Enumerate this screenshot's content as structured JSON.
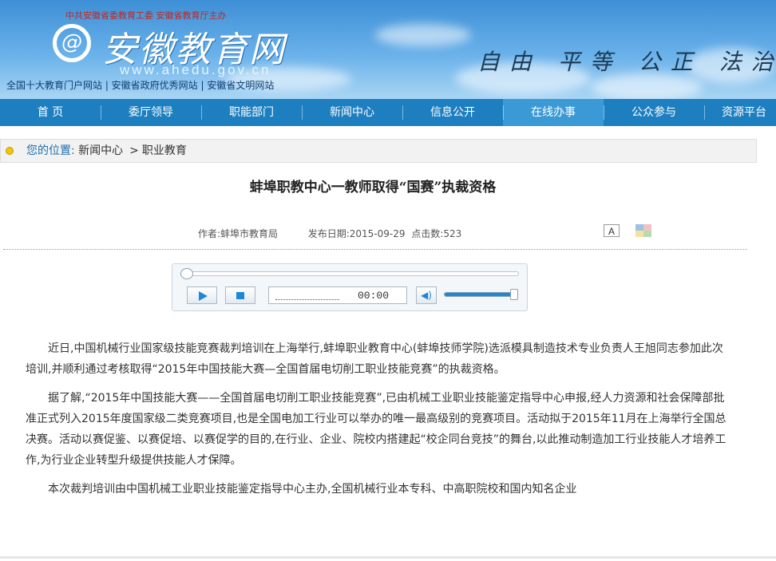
{
  "header": {
    "sponsor": "中共安徽省委教育工委 安徽省教育厅主办",
    "logo_text": "安徽教育网",
    "logo_url": "www.ahedu.gov.cn",
    "tagline": "全国十大教育门户网站 | 安徽省政府优秀网站 | 安徽省文明网站",
    "motto": "自由 平等 公正 法治"
  },
  "nav": {
    "items": [
      "首 页",
      "委厅领导",
      "职能部门",
      "新闻中心",
      "信息公开",
      "在线办事",
      "公众参与",
      "资源平台"
    ],
    "active_index": 5
  },
  "breadcrumb": {
    "label": "您的位置:",
    "section": "新闻中心",
    "separator": ">",
    "current": "职业教育"
  },
  "article": {
    "title": "蚌埠职教中心一教师取得“国赛”执裁资格",
    "author_label": "作者:",
    "author": "蚌埠市教育局",
    "date_label": "发布日期:",
    "date": "2015-09-29",
    "clicks_label": "点击数:",
    "clicks": "523",
    "font_button": "A",
    "paragraphs": [
      "近日,中国机械行业国家级技能竞赛裁判培训在上海举行,蚌埠职业教育中心(蚌埠技师学院)选派模具制造技术专业负责人王旭同志参加此次培训,并顺利通过考核取得“2015年中国技能大赛—全国首届电切削工职业技能竞赛”的执裁资格。",
      "据了解,“2015年中国技能大赛——全国首届电切削工职业技能竞赛”,已由机械工业职业技能鉴定指导中心申报,经人力资源和社会保障部批准正式列入2015年度国家级二类竞赛项目,也是全国电加工行业可以举办的唯一最高级别的竞赛项目。活动拟于2015年11月在上海举行全国总决赛。活动以赛促鉴、以赛促培、以赛促学的目的,在行业、企业、院校内搭建起“校企同台竞技”的舞台,以此推动制造加工行业技能人才培养工作,为行业企业转型升级提供技能人才保障。",
      "本次裁判培训由中国机械工业职业技能鉴定指导中心主办,全国机械行业本专科、中高职院校和国内知名企业"
    ]
  },
  "player": {
    "time": "00:00",
    "progress": 0,
    "volume": 1.0
  },
  "colors": {
    "nav_bg": "#1e7fc0",
    "nav_active": "#3b9ad6",
    "sponsor_red": "#c4261d",
    "breadcrumb_blue": "#1e6fb0"
  }
}
